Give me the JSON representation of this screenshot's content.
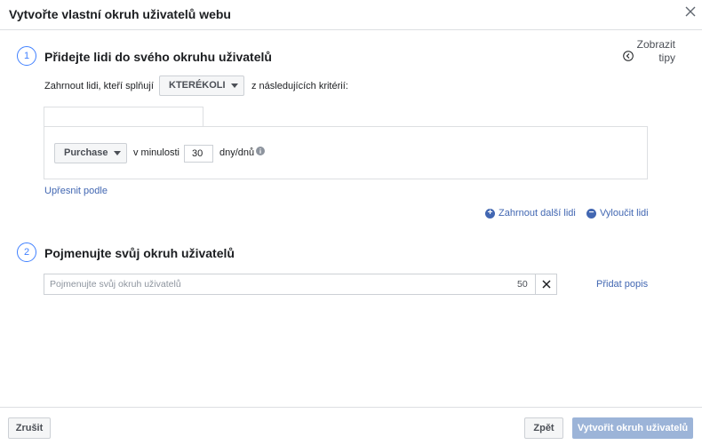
{
  "dialog": {
    "title": "Vytvořte vlastní okruh uživatelů webu"
  },
  "tips": {
    "line1": "Zobrazit",
    "line2": "tipy"
  },
  "step1": {
    "number": "1",
    "title": "Přidejte lidi do svého okruhu uživatelů",
    "include_prefix": "Zahrnout lidi, kteří splňují",
    "match_select": "KTERÉKOLI",
    "include_suffix": "z následujících kritérií:",
    "event_select": "Purchase",
    "in_last": "v minulosti",
    "days_value": "30",
    "days_unit": "dny/dnů",
    "refine_link": "Upřesnit podle",
    "include_more": "Zahrnout další lidi",
    "exclude": "Vyloučit lidi"
  },
  "step2": {
    "number": "2",
    "title": "Pojmenujte svůj okruh uživatelů",
    "name_placeholder": "Pojmenujte svůj okruh uživatelů",
    "char_counter": "50",
    "add_description": "Přidat popis"
  },
  "footer": {
    "cancel": "Zrušit",
    "back": "Zpět",
    "create": "Vytvořit okruh uživatelů"
  },
  "colors": {
    "accent": "#4267b2",
    "step_circle": "#4080ff",
    "disabled_primary": "#9cb4d8"
  }
}
